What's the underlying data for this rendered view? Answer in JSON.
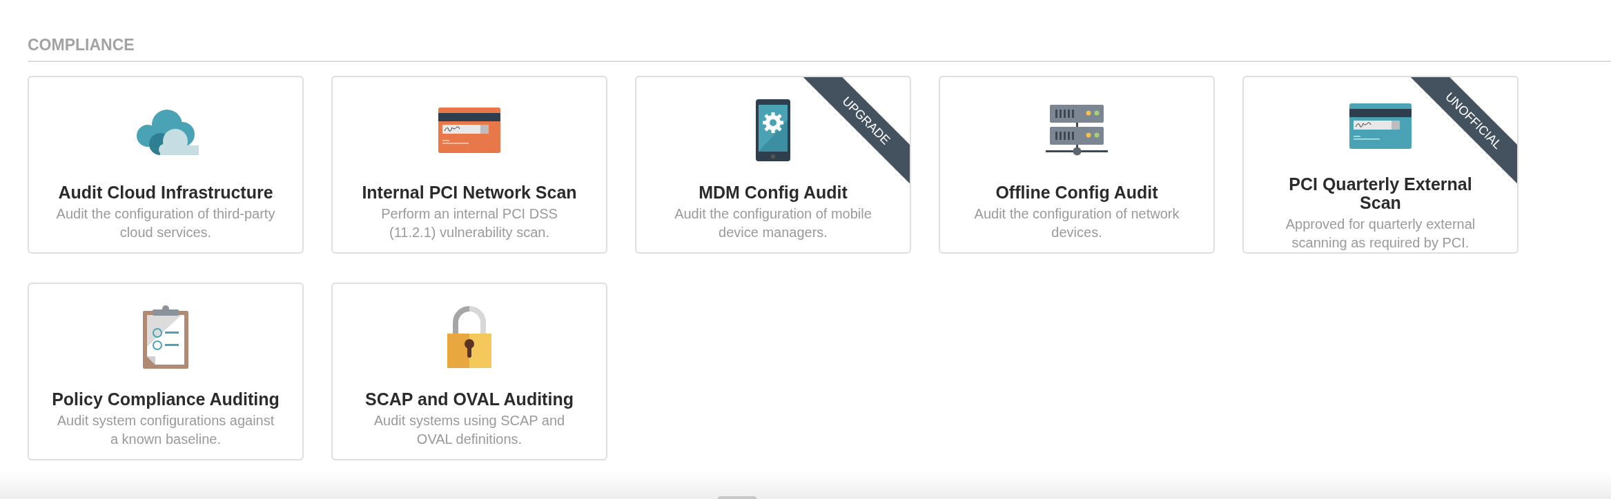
{
  "section": {
    "title": "COMPLIANCE"
  },
  "cards": [
    {
      "kind": "cloud",
      "title": "Audit Cloud Infrastructure",
      "description": "Audit the configuration of third-party cloud services."
    },
    {
      "kind": "card-orange",
      "title": "Internal PCI Network Scan",
      "description": "Perform an internal PCI DSS (11.2.1) vulnerability scan."
    },
    {
      "kind": "phone",
      "title": "MDM Config Audit",
      "description": "Audit the configuration of mobile device managers.",
      "ribbon": "UPGRADE"
    },
    {
      "kind": "server",
      "title": "Offline Config Audit",
      "description": "Audit the configuration of network devices."
    },
    {
      "kind": "card-teal",
      "title": "PCI Quarterly External Scan",
      "description": "Approved for quarterly external scanning as required by PCI.",
      "ribbon": "UNOFFICIAL"
    },
    {
      "kind": "clipboard",
      "title": "Policy Compliance Auditing",
      "description": "Audit system configurations against a known baseline."
    },
    {
      "kind": "padlock",
      "title": "SCAP and OVAL Auditing",
      "description": "Audit systems using SCAP and OVAL definitions."
    }
  ]
}
